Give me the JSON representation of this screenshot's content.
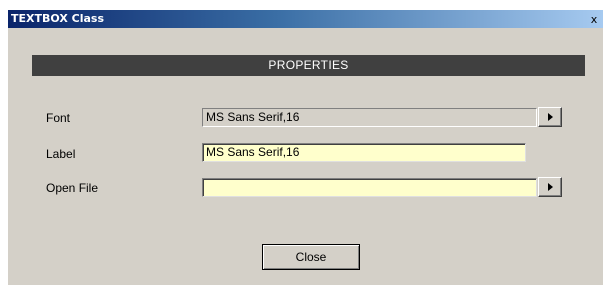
{
  "window": {
    "title": "TEXTBOX Class",
    "close_glyph": "x"
  },
  "section_header": "PROPERTIES",
  "properties": [
    {
      "label": "Font",
      "value": "MS Sans Serif,16",
      "editable": false,
      "has_browse_button": true
    },
    {
      "label": "Label",
      "value": "MS Sans Serif,16",
      "editable": true,
      "has_browse_button": false
    },
    {
      "label": "Open File",
      "value": "",
      "editable": true,
      "has_browse_button": true
    }
  ],
  "buttons": {
    "close_label": "Close"
  },
  "colors": {
    "dialog_background": "#d4d0c8",
    "header_bar": "#404040",
    "editable_field": "#ffffcc",
    "titlebar_start": "#0a246a",
    "titlebar_end": "#a6caf0"
  },
  "icons": {
    "browse_button": "triangle-right-icon",
    "window_close": "close-icon"
  }
}
